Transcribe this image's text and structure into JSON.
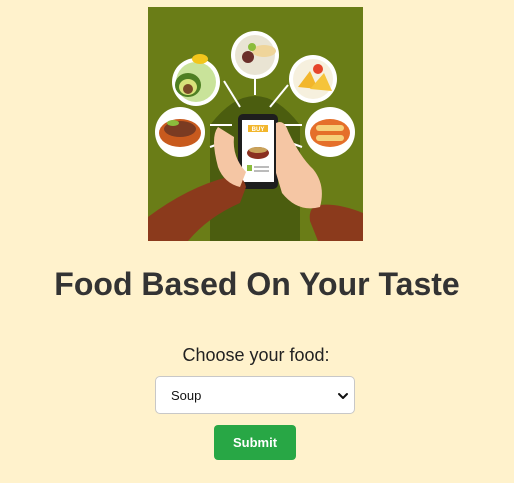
{
  "page": {
    "title": "Food Based On Your Taste"
  },
  "image": {
    "icon": "food-ordering-illustration",
    "buy_label": "BUY"
  },
  "form": {
    "label": "Choose your food:",
    "selected_option": "Soup",
    "submit_label": "Submit"
  },
  "colors": {
    "background": "#fff2cc",
    "image_background": "#6a7d17",
    "button": "#28a745",
    "title": "#333333"
  }
}
